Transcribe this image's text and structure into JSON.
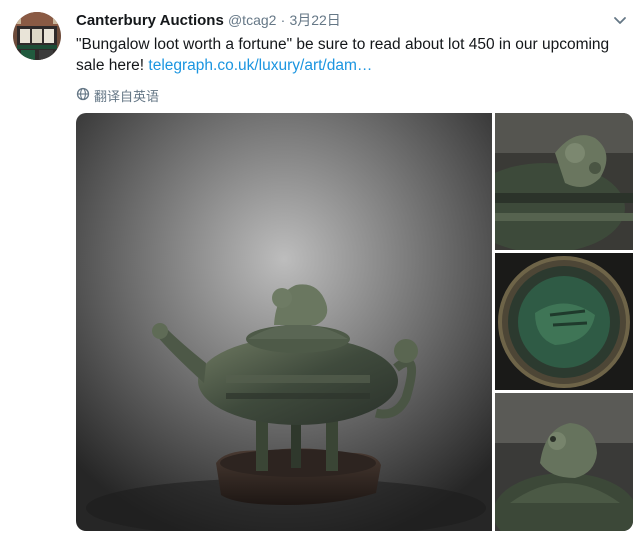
{
  "tweet": {
    "display_name": "Canterbury Auctions",
    "handle": "@tcag2",
    "separator": "·",
    "date": "3月22日",
    "text": "\"Bungalow loot worth a fortune\" be sure to read about lot 450 in our upcoming sale here! ",
    "link": "telegraph.co.uk/luxury/art/dam…",
    "translate_label": "翻译自英语"
  },
  "icons": {
    "avatar": "avatar",
    "caret": "chevron-down-icon",
    "translate": "globe-icon"
  },
  "colors": {
    "link": "#1b95e0",
    "secondary_text": "#657786",
    "primary_text": "#14171a"
  }
}
